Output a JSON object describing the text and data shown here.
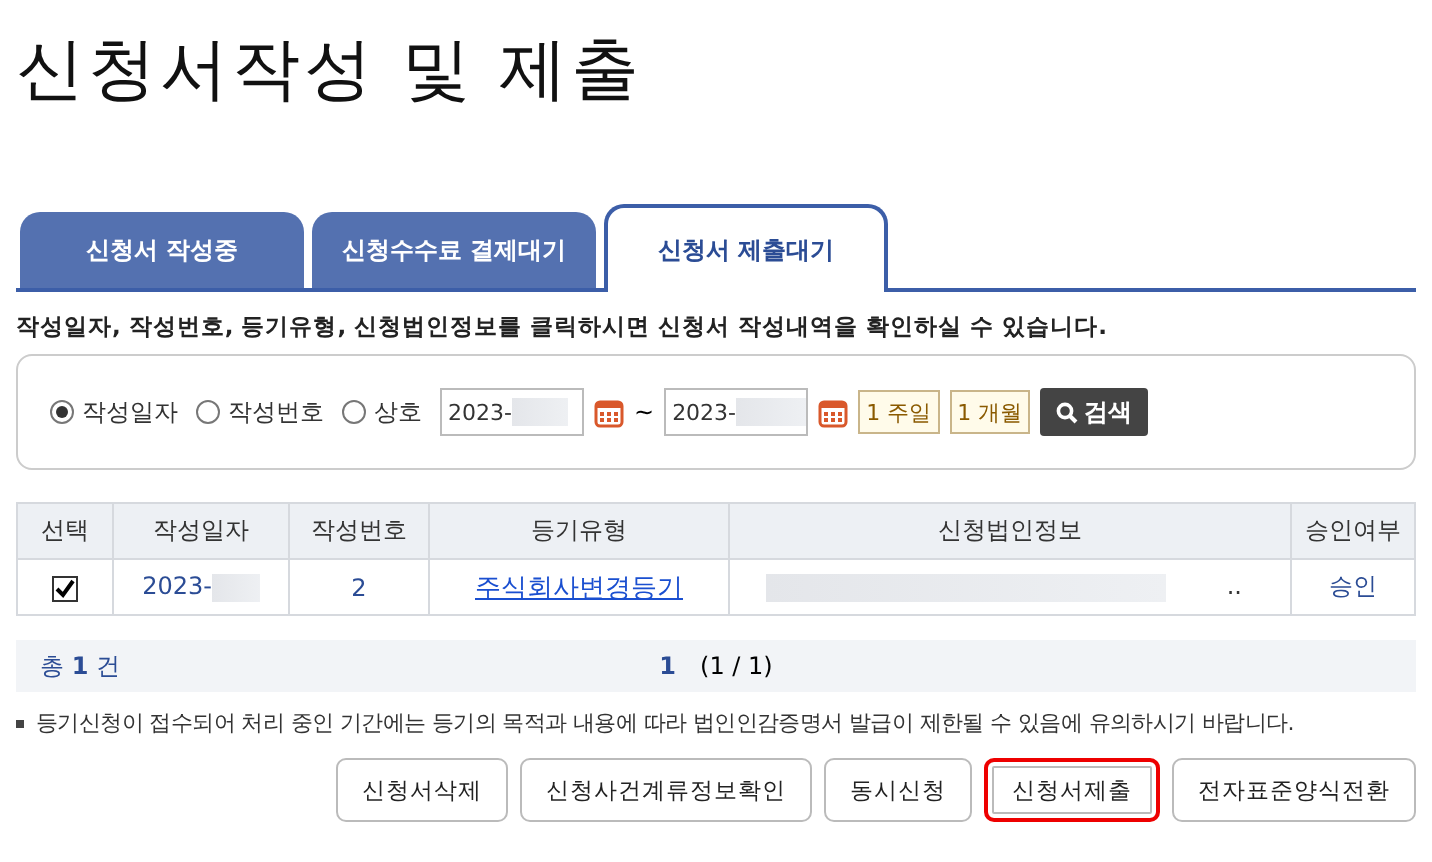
{
  "title": "신청서작성 및 제출",
  "tabs": [
    {
      "label": "신청서 작성중",
      "selected": false
    },
    {
      "label": "신청수수료 결제대기",
      "selected": false
    },
    {
      "label": "신청서 제출대기",
      "selected": true
    }
  ],
  "instruction": "작성일자, 작성번호, 등기유형, 신청법인정보를 클릭하시면 신청서 작성내역을 확인하실 수 있습니다.",
  "search": {
    "options": [
      {
        "label": "작성일자",
        "selected": true
      },
      {
        "label": "작성번호",
        "selected": false
      },
      {
        "label": "상호",
        "selected": false
      }
    ],
    "date_from": "2023-",
    "date_to": "2023-",
    "separator": "~",
    "periods": [
      "1 주일",
      "1 개월"
    ],
    "button": "검색"
  },
  "table": {
    "columns": [
      "선택",
      "작성일자",
      "작성번호",
      "등기유형",
      "신청법인정보",
      "승인여부"
    ],
    "rows": [
      {
        "checked": true,
        "date": "2023-",
        "number": "2",
        "type": "주식회사변경등기",
        "corp_info": "..",
        "approval": "승인"
      }
    ]
  },
  "summary": {
    "total_prefix": "총",
    "total_count": "1",
    "total_suffix": "건",
    "page": "1",
    "page_info": "(1 / 1)"
  },
  "notice": "등기신청이 접수되어 처리 중인 기간에는 등기의 목적과 내용에 따라 법인인감증명서 발급이 제한될 수 있음에 유의하시기 바랍니다.",
  "buttons": [
    {
      "label": "신청서삭제",
      "highlighted": false
    },
    {
      "label": "신청사건계류정보확인",
      "highlighted": false
    },
    {
      "label": "동시신청",
      "highlighted": false
    },
    {
      "label": "신청서제출",
      "highlighted": true
    },
    {
      "label": "전자표준양식전환",
      "highlighted": false
    }
  ]
}
